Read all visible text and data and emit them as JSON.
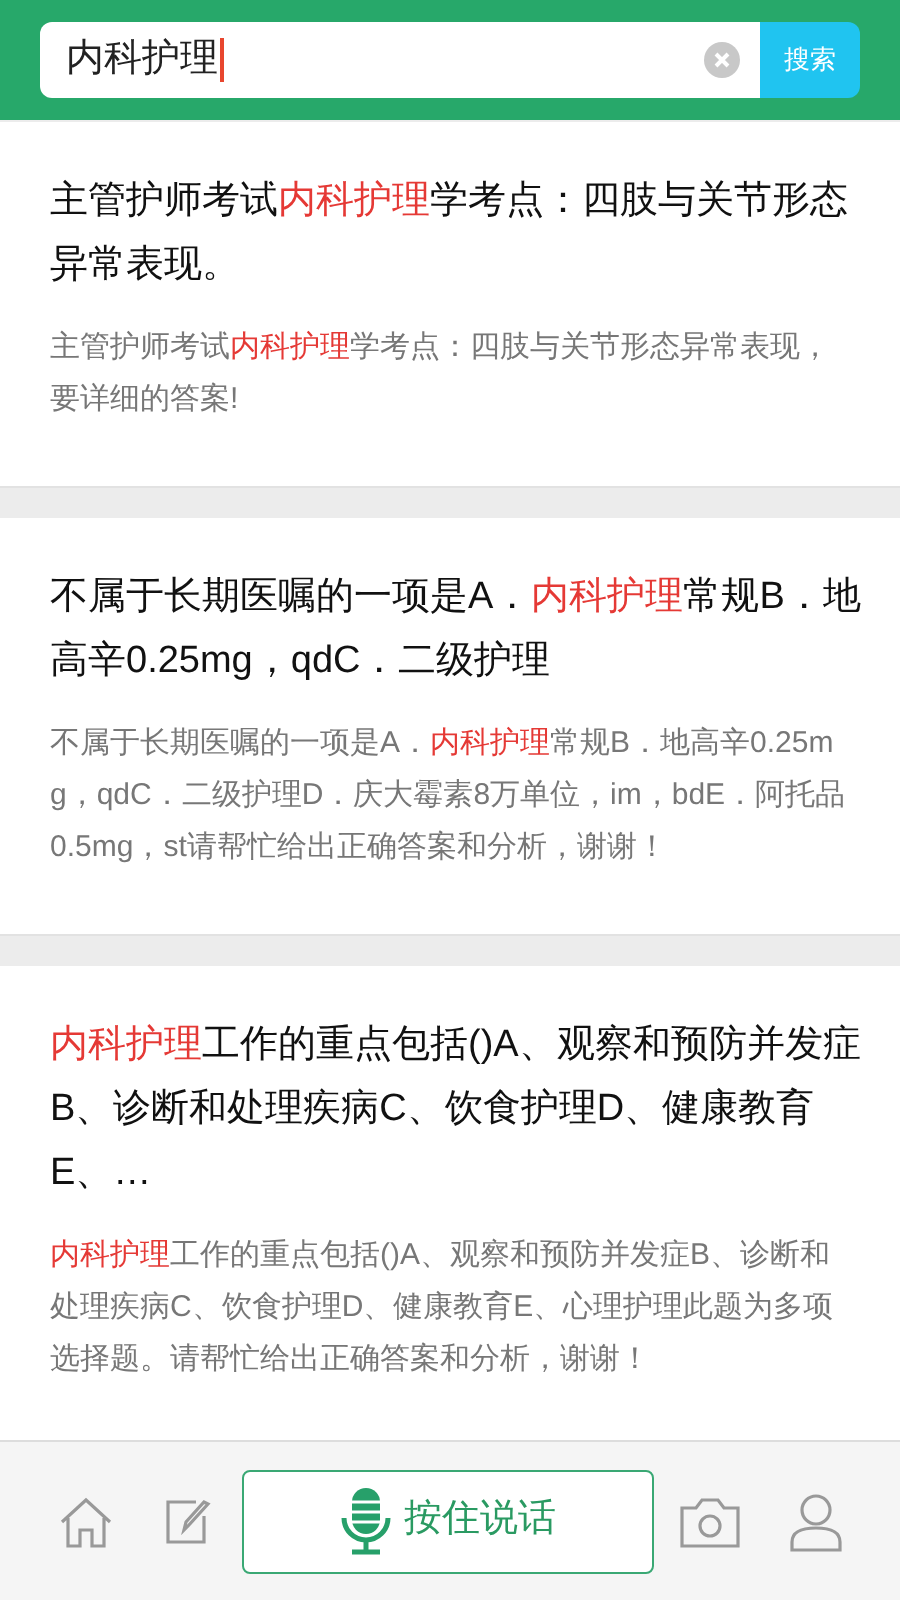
{
  "search": {
    "value": "内科护理",
    "button": "搜索"
  },
  "results": [
    {
      "title": [
        {
          "text": "主管护师考试",
          "highlight": false
        },
        {
          "text": "内科护理",
          "highlight": true
        },
        {
          "text": "学考点：四肢与关节形态异常表现。",
          "highlight": false
        }
      ],
      "summary": [
        {
          "text": "主管护师考试",
          "highlight": false
        },
        {
          "text": "内科护理",
          "highlight": true
        },
        {
          "text": "学考点：四肢与关节形态异常表现，要详细的答案!",
          "highlight": false
        }
      ]
    },
    {
      "title": [
        {
          "text": "不属于长期医嘱的一项是A．",
          "highlight": false
        },
        {
          "text": "内科护理",
          "highlight": true
        },
        {
          "text": "常规B．地高辛0.25mg，qdC．二级护理",
          "highlight": false
        }
      ],
      "summary": [
        {
          "text": "不属于长期医嘱的一项是A．",
          "highlight": false
        },
        {
          "text": "内科护理",
          "highlight": true
        },
        {
          "text": "常规B．地高辛0.25mg，qdC．二级护理D．庆大霉素8万单位，im，bdE．阿托品0.5mg，st请帮忙给出正确答案和分析，谢谢！",
          "highlight": false
        }
      ]
    },
    {
      "title": [
        {
          "text": "内科护理",
          "highlight": true
        },
        {
          "text": "工作的重点包括()A、观察和预防并发症B、诊断和处理疾病C、饮食护理D、健康教育E、…",
          "highlight": false
        }
      ],
      "summary": [
        {
          "text": "内科护理",
          "highlight": true
        },
        {
          "text": "工作的重点包括()A、观察和预防并发症B、诊断和处理疾病C、饮食护理D、健康教育E、心理护理此题为多项选择题。请帮忙给出正确答案和分析，谢谢！",
          "highlight": false
        }
      ]
    }
  ],
  "bottom_bar": {
    "voice_button": "按住说话"
  }
}
